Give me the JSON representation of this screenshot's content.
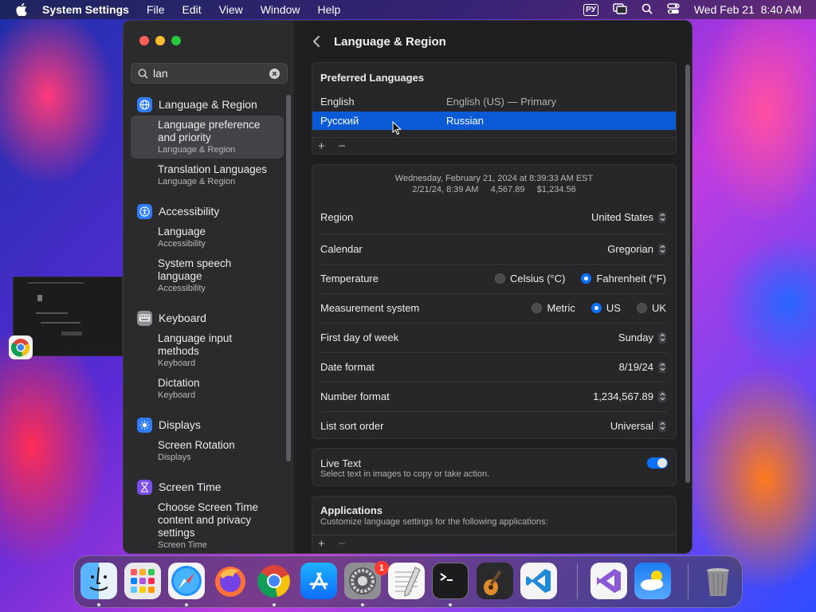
{
  "menubar": {
    "app_name": "System Settings",
    "items": [
      "File",
      "Edit",
      "View",
      "Window",
      "Help"
    ],
    "input_source": "РУ",
    "datetime": "Wed Feb 21  8:40 AM"
  },
  "sidebar": {
    "search": {
      "value": "lan",
      "placeholder": "Search"
    },
    "sections": [
      {
        "category": "Language & Region",
        "results": [
          {
            "title": "Language preference and priority",
            "subtitle": "Language & Region"
          },
          {
            "title": "Translation Languages",
            "subtitle": "Language & Region"
          }
        ]
      },
      {
        "category": "Accessibility",
        "results": [
          {
            "title": "Language",
            "subtitle": "Accessibility"
          },
          {
            "title": "System speech language",
            "subtitle": "Accessibility"
          }
        ]
      },
      {
        "category": "Keyboard",
        "results": [
          {
            "title": "Language input methods",
            "subtitle": "Keyboard"
          },
          {
            "title": "Dictation",
            "subtitle": "Keyboard"
          }
        ]
      },
      {
        "category": "Displays",
        "results": [
          {
            "title": "Screen Rotation",
            "subtitle": "Displays"
          }
        ]
      },
      {
        "category": "Screen Time",
        "results": [
          {
            "title": "Choose Screen Time content and privacy settings",
            "subtitle": "Screen Time"
          }
        ]
      }
    ]
  },
  "content": {
    "title": "Language & Region",
    "preferred_languages": {
      "title": "Preferred Languages",
      "rows": [
        {
          "name": "English",
          "detail": "English (US) — Primary"
        },
        {
          "name": "Русский",
          "detail": "Russian"
        }
      ]
    },
    "format_preview": {
      "line1": "Wednesday, February 21, 2024 at 8:39:33 AM EST",
      "line2": "2/21/24, 8:39 AM     4,567.89     $1,234.56"
    },
    "settings": {
      "region": {
        "label": "Region",
        "value": "United States"
      },
      "calendar": {
        "label": "Calendar",
        "value": "Gregorian"
      },
      "temperature": {
        "label": "Temperature",
        "options": [
          "Celsius (°C)",
          "Fahrenheit (°F)"
        ],
        "selected": "Fahrenheit (°F)"
      },
      "measurement": {
        "label": "Measurement system",
        "options": [
          "Metric",
          "US",
          "UK"
        ],
        "selected": "US"
      },
      "first_day": {
        "label": "First day of week",
        "value": "Sunday"
      },
      "date_format": {
        "label": "Date format",
        "value": "8/19/24"
      },
      "number_format": {
        "label": "Number format",
        "value": "1,234,567.89"
      },
      "sort_order": {
        "label": "List sort order",
        "value": "Universal"
      }
    },
    "live_text": {
      "title": "Live Text",
      "subtitle": "Select text in images to copy or take action.",
      "enabled": true
    },
    "applications": {
      "title": "Applications",
      "subtitle": "Customize language settings for the following applications:"
    }
  },
  "dock": {
    "apps": [
      "Finder",
      "Launchpad",
      "Safari",
      "Firefox",
      "Chrome",
      "App Store",
      "System Settings",
      "TextEdit",
      "Terminal",
      "GarageBand",
      "VS Code",
      "Visual Studio",
      "Weather",
      "Trash"
    ],
    "settings_badge": "1"
  },
  "colors": {
    "accent": "#0a72ff",
    "selection": "#0a5ad6"
  }
}
